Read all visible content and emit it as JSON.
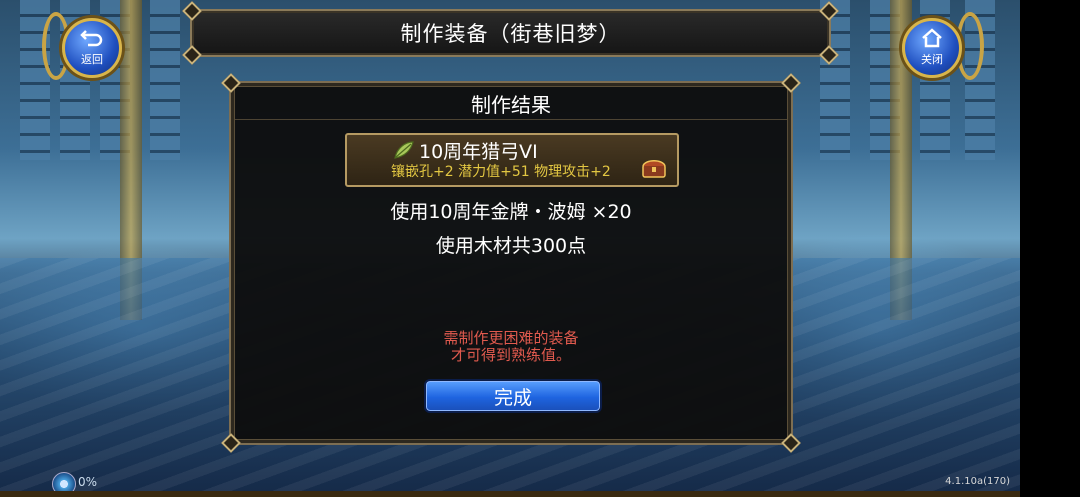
{
  "header": {
    "title": "制作装备（街巷旧梦）"
  },
  "nav": {
    "back_label": "返回",
    "close_label": "关闭"
  },
  "result_panel": {
    "title": "制作结果",
    "item": {
      "name": "10周年猎弓VI",
      "stats": "镶嵌孔+2 潜力值+51 物理攻击+2"
    },
    "cost_line_1": "使用10周年金牌・波姆 ×20",
    "cost_line_2": "使用木材共300点",
    "notice_line_1": "需制作更困难的装备",
    "notice_line_2": "才可得到熟练值。",
    "done_label": "完成"
  },
  "status": {
    "progress_text": "0%",
    "progress_fraction": 0,
    "version": "4.1.10a(170)"
  },
  "colors": {
    "title_text": "#ffffff",
    "stat_text": "#e3c742",
    "notice_text": "#e05a4e",
    "button_blue": "#1e64e0",
    "frame_gold": "#c9a445"
  },
  "icons": [
    "back-arrow-icon",
    "home-icon",
    "leaf-weapon-icon",
    "treasure-chest-icon",
    "loading-orb-icon"
  ]
}
